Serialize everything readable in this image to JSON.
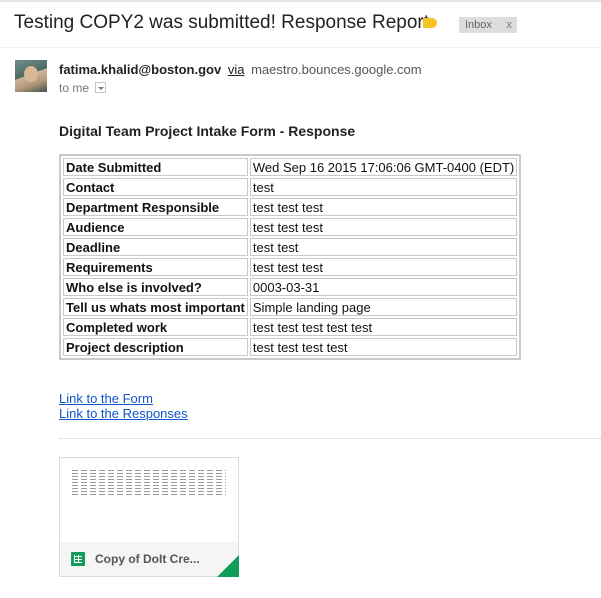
{
  "email": {
    "subject": "Testing COPY2 was submitted! Response Report",
    "label": {
      "color": "#f5c324"
    },
    "inbox_chip": {
      "label": "Inbox",
      "close": "x"
    },
    "sender": {
      "email": "fatima.khalid@boston.gov",
      "via_label": "via",
      "via_domain": "maestro.bounces.google.com"
    },
    "to_line": "to me"
  },
  "body": {
    "form_title": "Digital Team Project Intake Form - Response",
    "rows": [
      {
        "key": "Date Submitted",
        "value": "Wed Sep 16 2015 17:06:06 GMT-0400 (EDT)"
      },
      {
        "key": "Contact",
        "value": "test"
      },
      {
        "key": "Department Responsible",
        "value": "test test test"
      },
      {
        "key": "Audience",
        "value": "test test test"
      },
      {
        "key": "Deadline",
        "value": "test test"
      },
      {
        "key": "Requirements",
        "value": "test test test"
      },
      {
        "key": "Who else is involved?",
        "value": "0003-03-31"
      },
      {
        "key": "Tell us whats most important",
        "value": "Simple landing page"
      },
      {
        "key": "Completed work",
        "value": "test test test test test"
      },
      {
        "key": "Project description",
        "value": "test test test test"
      }
    ],
    "links": {
      "form": "Link to the Form ",
      "responses": "Link to the Responses"
    }
  },
  "attachment": {
    "name": "Copy of DoIt Cre...",
    "icon": "google-sheets-icon",
    "accent_color": "#0f9d58"
  },
  "colors": {
    "link": "#1155cc",
    "chip_bg": "#dddddd"
  }
}
